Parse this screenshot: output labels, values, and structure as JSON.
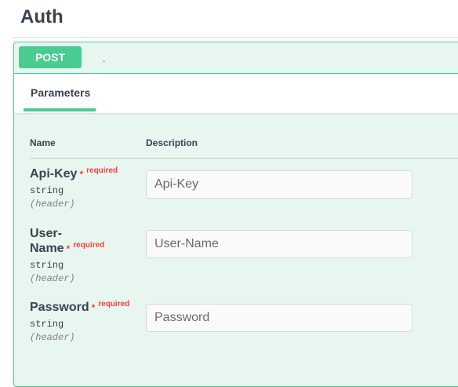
{
  "section": {
    "title": "Auth"
  },
  "operation": {
    "method": "POST",
    "path": "."
  },
  "tabs": {
    "parameters_label": "Parameters"
  },
  "table": {
    "name_header": "Name",
    "description_header": "Description"
  },
  "params": [
    {
      "name": "Api-Key",
      "star": "*",
      "required": "required",
      "type": "string",
      "in": "(header)",
      "placeholder": "Api-Key"
    },
    {
      "name_line1": "User-",
      "name_line2": "Name",
      "star": "*",
      "required": "required",
      "type": "string",
      "in": "(header)",
      "placeholder": "User-Name"
    },
    {
      "name": "Password",
      "star": "*",
      "required": "required",
      "type": "string",
      "in": "(header)",
      "placeholder": "Password"
    }
  ],
  "colors": {
    "post_green": "#49cc90",
    "post_bg": "#e8f6f0",
    "required_red": "#f93e3e",
    "text": "#3b4151"
  }
}
